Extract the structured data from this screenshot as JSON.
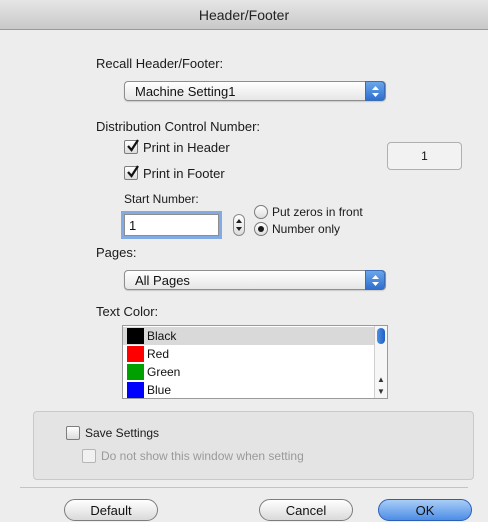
{
  "window": {
    "title": "Header/Footer"
  },
  "recall": {
    "label": "Recall Header/Footer:",
    "selected": "Machine Setting1"
  },
  "distribution": {
    "label": "Distribution Control Number:",
    "print_header_label": "Print in Header",
    "print_header_checked": true,
    "print_footer_label": "Print in Footer",
    "print_footer_checked": true,
    "counter_value": "1",
    "start_number_label": "Start Number:",
    "start_number_value": "1",
    "radio_zeros_label": "Put zeros in front",
    "radio_number_only_label": "Number only",
    "selected_radio": "Number only"
  },
  "pages": {
    "label": "Pages:",
    "selected": "All Pages"
  },
  "text_color": {
    "label": "Text Color:",
    "items": [
      {
        "name": "Black",
        "color": "#000000",
        "selected": true
      },
      {
        "name": "Red",
        "color": "#ff0000",
        "selected": false
      },
      {
        "name": "Green",
        "color": "#00a000",
        "selected": false
      },
      {
        "name": "Blue",
        "color": "#0000ff",
        "selected": false
      }
    ]
  },
  "settings": {
    "save_label": "Save Settings",
    "save_checked": false,
    "dont_show_label": "Do not show this window when setting",
    "dont_show_checked": false,
    "dont_show_enabled": false
  },
  "buttons": {
    "default_label": "Default",
    "cancel_label": "Cancel",
    "ok_label": "OK"
  },
  "colors": {
    "accent": "#3a7be0",
    "window_bg": "#ededed"
  }
}
